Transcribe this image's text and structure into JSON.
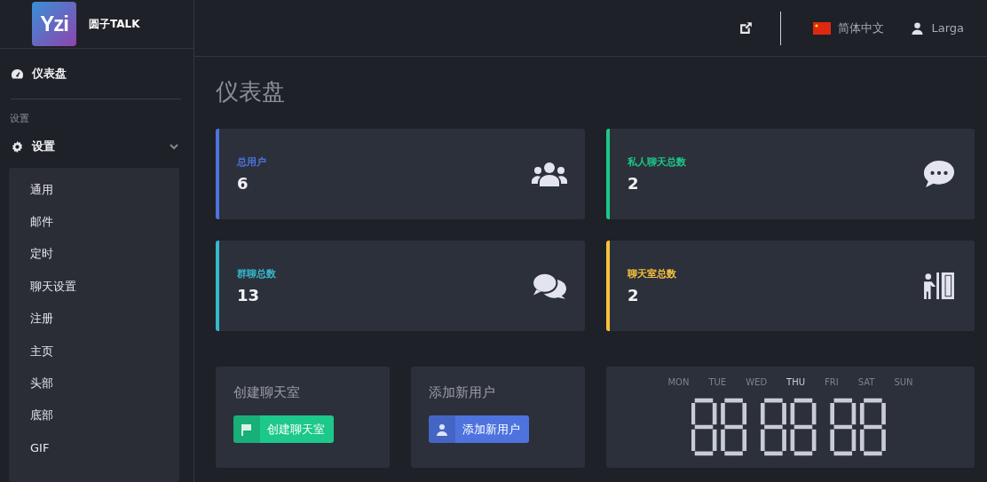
{
  "brand": {
    "logo_text": "Yzi",
    "name": "圆子TALK"
  },
  "topbar": {
    "language": "简体中文",
    "user": "Larga"
  },
  "sidebar": {
    "main_item": {
      "label": "仪表盘"
    },
    "section_heading": "设置",
    "group": {
      "label": "设置",
      "expanded": true,
      "children": [
        {
          "label": "通用"
        },
        {
          "label": "邮件"
        },
        {
          "label": "定时"
        },
        {
          "label": "聊天设置"
        },
        {
          "label": "注册"
        },
        {
          "label": "主页"
        },
        {
          "label": "头部"
        },
        {
          "label": "底部"
        },
        {
          "label": "GIF"
        }
      ]
    }
  },
  "page_title": "仪表盘",
  "stat_cards": [
    {
      "label": "总用户",
      "value": "6",
      "color": "#4e73df",
      "kind": "users"
    },
    {
      "label": "私人聊天总数",
      "value": "2",
      "color": "#1cc88a",
      "kind": "comment"
    },
    {
      "label": "群聊总数",
      "value": "13",
      "color": "#36b9cc",
      "kind": "comments"
    },
    {
      "label": "聊天室总数",
      "value": "2",
      "color": "#f6c23e",
      "kind": "room"
    }
  ],
  "action_cards": [
    {
      "title": "创建聊天室",
      "button": "创建聊天室",
      "color": "#1cc88a",
      "kind": "flag"
    },
    {
      "title": "添加新用户",
      "button": "添加新用户",
      "color": "#4e73df",
      "kind": "user"
    }
  ],
  "clock": {
    "days": [
      {
        "label": "MON",
        "selected": false
      },
      {
        "label": "TUE",
        "selected": false
      },
      {
        "label": "WED",
        "selected": false
      },
      {
        "label": "THU",
        "selected": true
      },
      {
        "label": "FRI",
        "selected": false
      },
      {
        "label": "SAT",
        "selected": false
      },
      {
        "label": "SUN",
        "selected": false
      }
    ]
  }
}
